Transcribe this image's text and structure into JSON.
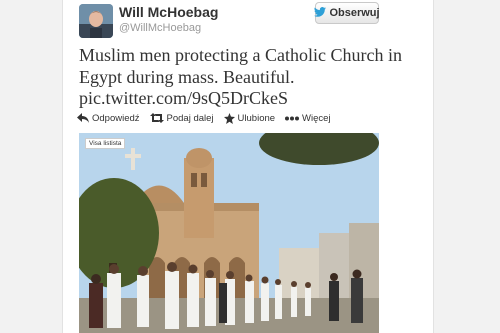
{
  "tweet": {
    "author_name": "Will McHoebag",
    "author_handle": "@WillMcHoebag",
    "follow_label": "Obserwuj",
    "text": "Muslim men protecting a Catholic Church in Egypt during mass. Beautiful.",
    "link": "pic.twitter.com/9sQ5DrCkeS",
    "actions": [
      {
        "label": "Odpowiedź",
        "icon": "reply-icon"
      },
      {
        "label": "Podaj dalej",
        "icon": "retweet-icon"
      },
      {
        "label": "Ulubione",
        "icon": "star-icon"
      },
      {
        "label": "Więcej",
        "icon": "more-dots-icon"
      }
    ],
    "photo_badge": "Visa listista"
  },
  "colors": {
    "twitter_blue": "#2ea0d7",
    "text": "#333333",
    "muted": "#999999",
    "background": "#f2f2f2"
  }
}
